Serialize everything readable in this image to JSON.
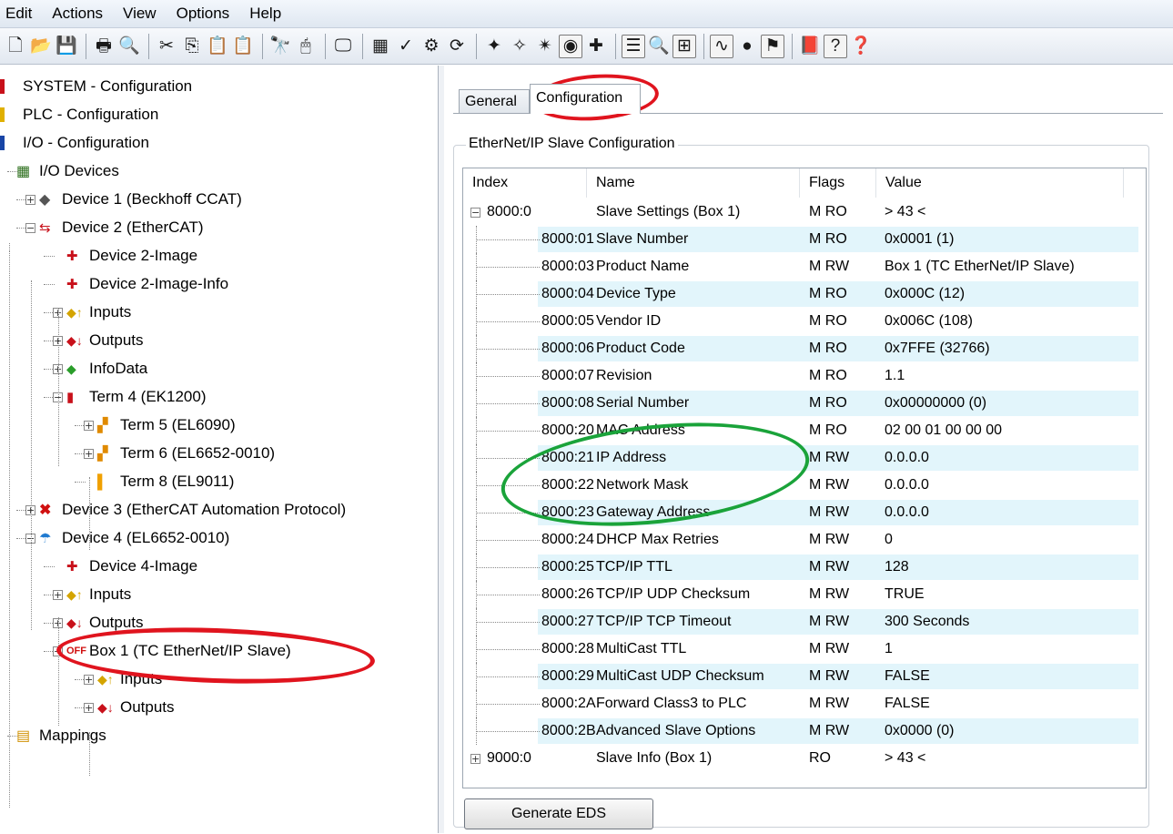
{
  "menu": [
    "Edit",
    "Actions",
    "View",
    "Options",
    "Help"
  ],
  "toolbar": {
    "groups": [
      [
        "new-icon",
        "open-icon",
        "save-icon"
      ],
      [
        "print-icon",
        "print-preview-icon"
      ],
      [
        "cut-icon",
        "copy-icon",
        "paste-icon",
        "paste-with-links-icon"
      ],
      [
        "find-icon",
        "mouse-icon"
      ],
      [
        "monitor-icon"
      ],
      [
        "generate-mappings-icon",
        "check-configuration-icon",
        "activate-configuration-icon",
        "restart-icon"
      ],
      [
        "config-mode-icon",
        "scan-devices-icon",
        "toggle-free-run-icon",
        "show-online-icon",
        "select-target-icon"
      ],
      [
        "list-view-icon",
        "zoom-icon",
        "show-sub-items-icon"
      ],
      [
        "oscilloscope-icon",
        "set-breakpoint-icon",
        "force-icon"
      ],
      [
        "book-icon",
        "help-icon",
        "help-topics-icon"
      ]
    ]
  },
  "tree": [
    {
      "label": "SYSTEM - Configuration",
      "icon": "system-icon"
    },
    {
      "label": "PLC - Configuration",
      "icon": "plc-icon"
    },
    {
      "label": "I/O - Configuration",
      "icon": "io-icon"
    },
    {
      "label": "I/O Devices",
      "icon": "io-devices-icon"
    },
    {
      "label": "Device 1 (Beckhoff CCAT)",
      "icon": "ccat-icon"
    },
    {
      "label": "Device 2 (EtherCAT)",
      "icon": "ethercat-device-icon"
    },
    {
      "label": "Device 2-Image",
      "icon": "image-icon"
    },
    {
      "label": "Device 2-Image-Info",
      "icon": "image-icon"
    },
    {
      "label": "Inputs",
      "icon": "inputs-icon"
    },
    {
      "label": "Outputs",
      "icon": "outputs-icon"
    },
    {
      "label": "InfoData",
      "icon": "infodata-icon"
    },
    {
      "label": "Term 4 (EK1200)",
      "icon": "coupler-icon"
    },
    {
      "label": "Term 5 (EL6090)",
      "icon": "terminal-icon"
    },
    {
      "label": "Term 6 (EL6652-0010)",
      "icon": "terminal-icon"
    },
    {
      "label": "Term 8 (EL9011)",
      "icon": "end-terminal-icon"
    },
    {
      "label": "Device 3 (EtherCAT Automation Protocol)",
      "icon": "disabled-device-icon"
    },
    {
      "label": "Device 4 (EL6652-0010)",
      "icon": "ethernet-ip-device-icon"
    },
    {
      "label": "Device 4-Image",
      "icon": "image-icon"
    },
    {
      "label": "Inputs",
      "icon": "inputs-icon"
    },
    {
      "label": "Outputs",
      "icon": "outputs-icon"
    },
    {
      "label": "Box 1 (TC EtherNet/IP Slave)",
      "icon": "box-off-icon"
    },
    {
      "label": "Inputs",
      "icon": "inputs-icon"
    },
    {
      "label": "Outputs",
      "icon": "outputs-icon"
    },
    {
      "label": "Mappings",
      "icon": "mappings-icon"
    }
  ],
  "tabs": [
    "General",
    "Configuration"
  ],
  "active_tab": "Configuration",
  "group_title": "EtherNet/IP Slave Configuration",
  "columns": [
    "Index",
    "Name",
    "Flags",
    "Value"
  ],
  "rows": [
    {
      "index": "8000:0",
      "name": "Slave Settings (Box 1)",
      "flags": "M RO",
      "value": "> 43 <",
      "expander": "minus"
    },
    {
      "index": "8000:01",
      "name": "Slave Number",
      "flags": "M RO",
      "value": "0x0001 (1)"
    },
    {
      "index": "8000:03",
      "name": "Product Name",
      "flags": "M RW",
      "value": "Box 1 (TC EtherNet/IP Slave)"
    },
    {
      "index": "8000:04",
      "name": "Device Type",
      "flags": "M RO",
      "value": "0x000C (12)"
    },
    {
      "index": "8000:05",
      "name": "Vendor ID",
      "flags": "M RO",
      "value": "0x006C (108)"
    },
    {
      "index": "8000:06",
      "name": "Product Code",
      "flags": "M RO",
      "value": "0x7FFE (32766)"
    },
    {
      "index": "8000:07",
      "name": "Revision",
      "flags": "M RO",
      "value": "1.1"
    },
    {
      "index": "8000:08",
      "name": "Serial Number",
      "flags": "M RO",
      "value": "0x00000000 (0)"
    },
    {
      "index": "8000:20",
      "name": "MAC Address",
      "flags": "M RO",
      "value": "02 00 01 00 00 00"
    },
    {
      "index": "8000:21",
      "name": "IP Address",
      "flags": "M RW",
      "value": "0.0.0.0"
    },
    {
      "index": "8000:22",
      "name": "Network Mask",
      "flags": "M RW",
      "value": "0.0.0.0"
    },
    {
      "index": "8000:23",
      "name": "Gateway Address",
      "flags": "M RW",
      "value": "0.0.0.0"
    },
    {
      "index": "8000:24",
      "name": "DHCP Max Retries",
      "flags": "M RW",
      "value": "0"
    },
    {
      "index": "8000:25",
      "name": "TCP/IP TTL",
      "flags": "M RW",
      "value": "128"
    },
    {
      "index": "8000:26",
      "name": "TCP/IP UDP Checksum",
      "flags": "M RW",
      "value": "TRUE"
    },
    {
      "index": "8000:27",
      "name": "TCP/IP TCP Timeout",
      "flags": "M RW",
      "value": "300 Seconds"
    },
    {
      "index": "8000:28",
      "name": "MultiCast TTL",
      "flags": "M RW",
      "value": "1"
    },
    {
      "index": "8000:29",
      "name": "MultiCast UDP Checksum",
      "flags": "M RW",
      "value": "FALSE"
    },
    {
      "index": "8000:2A",
      "name": "Forward Class3 to PLC",
      "flags": "M RW",
      "value": "FALSE"
    },
    {
      "index": "8000:2B",
      "name": "Advanced Slave Options",
      "flags": "M RW",
      "value": "0x0000 (0)"
    },
    {
      "index": "9000:0",
      "name": "Slave Info (Box 1)",
      "flags": "RO",
      "value": "> 43 <",
      "expander": "plus"
    }
  ],
  "generate_button": "Generate EDS",
  "annotation_colors": {
    "red": "#e0141e",
    "green": "#1aa33a"
  },
  "row_highlight_color": "#e2f5fb"
}
